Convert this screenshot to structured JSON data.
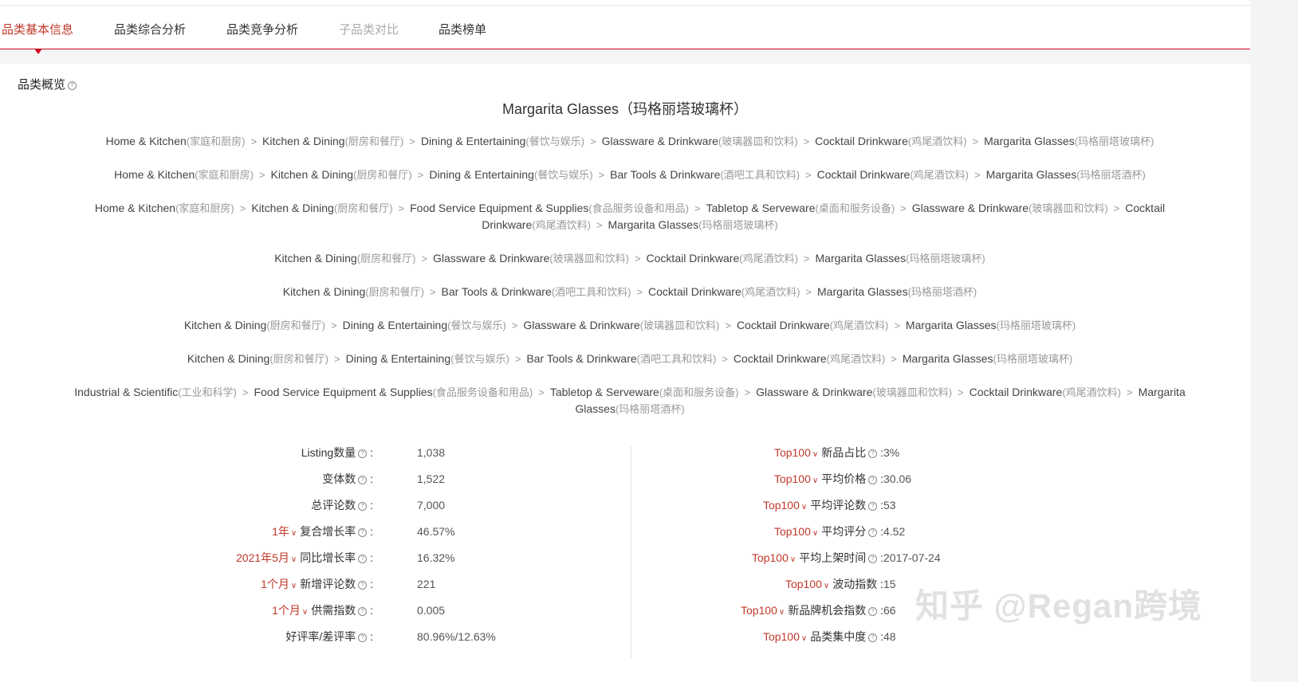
{
  "tabs": [
    {
      "label": "品类基本信息",
      "state": "active"
    },
    {
      "label": "品类综合分析",
      "state": "normal"
    },
    {
      "label": "品类竞争分析",
      "state": "normal"
    },
    {
      "label": "子品类对比",
      "state": "disabled"
    },
    {
      "label": "品类榜单",
      "state": "normal"
    }
  ],
  "section_title": "品类概览",
  "category_title": "Margarita Glasses（玛格丽塔玻璃杯）",
  "paths": [
    {
      "segments": [
        {
          "en": "Home & Kitchen",
          "cn": "(家庭和厨房)"
        },
        {
          "en": "Kitchen & Dining",
          "cn": "(厨房和餐厅)"
        },
        {
          "en": "Dining & Entertaining",
          "cn": "(餐饮与娱乐)"
        },
        {
          "en": "Glassware & Drinkware",
          "cn": "(玻璃器皿和饮料)"
        },
        {
          "en": "Cocktail Drinkware",
          "cn": "(鸡尾酒饮料)"
        },
        {
          "en": "Margarita Glasses",
          "cn": "(玛格丽塔玻璃杯)"
        }
      ]
    },
    {
      "segments": [
        {
          "en": "Home & Kitchen",
          "cn": "(家庭和厨房)"
        },
        {
          "en": "Kitchen & Dining",
          "cn": "(厨房和餐厅)"
        },
        {
          "en": "Dining & Entertaining",
          "cn": "(餐饮与娱乐)"
        },
        {
          "en": "Bar Tools & Drinkware",
          "cn": "(酒吧工具和饮料)"
        },
        {
          "en": "Cocktail Drinkware",
          "cn": "(鸡尾酒饮料)"
        },
        {
          "en": "Margarita Glasses",
          "cn": "(玛格丽塔酒杯)"
        }
      ]
    },
    {
      "segments": [
        {
          "en": "Home & Kitchen",
          "cn": "(家庭和厨房)"
        },
        {
          "en": "Kitchen & Dining",
          "cn": "(厨房和餐厅)"
        },
        {
          "en": "Food Service Equipment & Supplies",
          "cn": "(食品服务设备和用品)"
        },
        {
          "en": "Tabletop & Serveware",
          "cn": "(桌面和服务设备)"
        },
        {
          "en": "Glassware & Drinkware",
          "cn": "(玻璃器皿和饮料)"
        },
        {
          "en": "Cocktail Drinkware",
          "cn": "(鸡尾酒饮料)"
        },
        {
          "en": "Margarita Glasses",
          "cn": "(玛格丽塔玻璃杯)"
        }
      ]
    },
    {
      "segments": [
        {
          "en": "Kitchen & Dining",
          "cn": "(厨房和餐厅)"
        },
        {
          "en": "Glassware & Drinkware",
          "cn": "(玻璃器皿和饮料)"
        },
        {
          "en": "Cocktail Drinkware",
          "cn": "(鸡尾酒饮料)"
        },
        {
          "en": "Margarita Glasses",
          "cn": "(玛格丽塔玻璃杯)"
        }
      ]
    },
    {
      "segments": [
        {
          "en": "Kitchen & Dining",
          "cn": "(厨房和餐厅)"
        },
        {
          "en": "Bar Tools & Drinkware",
          "cn": "(酒吧工具和饮料)"
        },
        {
          "en": "Cocktail Drinkware",
          "cn": "(鸡尾酒饮料)"
        },
        {
          "en": "Margarita Glasses",
          "cn": "(玛格丽塔酒杯)"
        }
      ]
    },
    {
      "segments": [
        {
          "en": "Kitchen & Dining",
          "cn": "(厨房和餐厅)"
        },
        {
          "en": "Dining & Entertaining",
          "cn": "(餐饮与娱乐)"
        },
        {
          "en": "Glassware & Drinkware",
          "cn": "(玻璃器皿和饮料)"
        },
        {
          "en": "Cocktail Drinkware",
          "cn": "(鸡尾酒饮料)"
        },
        {
          "en": "Margarita Glasses",
          "cn": "(玛格丽塔玻璃杯)"
        }
      ]
    },
    {
      "segments": [
        {
          "en": "Kitchen & Dining",
          "cn": "(厨房和餐厅)"
        },
        {
          "en": "Dining & Entertaining",
          "cn": "(餐饮与娱乐)"
        },
        {
          "en": "Bar Tools & Drinkware",
          "cn": "(酒吧工具和饮料)"
        },
        {
          "en": "Cocktail Drinkware",
          "cn": "(鸡尾酒饮料)"
        },
        {
          "en": "Margarita Glasses",
          "cn": "(玛格丽塔玻璃杯)"
        }
      ]
    },
    {
      "segments": [
        {
          "en": "Industrial & Scientific",
          "cn": "(工业和科学)"
        },
        {
          "en": "Food Service Equipment & Supplies",
          "cn": "(食品服务设备和用品)"
        },
        {
          "en": "Tabletop & Serveware",
          "cn": "(桌面和服务设备)"
        },
        {
          "en": "Glassware & Drinkware",
          "cn": "(玻璃器皿和饮料)"
        },
        {
          "en": "Cocktail Drinkware",
          "cn": "(鸡尾酒饮料)"
        },
        {
          "en": "Margarita Glasses",
          "cn": "(玛格丽塔酒杯)"
        }
      ]
    }
  ],
  "metrics_left": [
    {
      "prefix": "",
      "label": "Listing数量",
      "help": true,
      "value": "1,038"
    },
    {
      "prefix": "",
      "label": "变体数",
      "help": true,
      "value": "1,522"
    },
    {
      "prefix": "",
      "label": "总评论数",
      "help": true,
      "value": "7,000"
    },
    {
      "prefix": "1年",
      "label": "复合增长率",
      "help": true,
      "value": "46.57%"
    },
    {
      "prefix": "2021年5月",
      "label": "同比增长率",
      "help": true,
      "value": "16.32%"
    },
    {
      "prefix": "1个月",
      "label": "新增评论数",
      "help": true,
      "value": "221"
    },
    {
      "prefix": "1个月",
      "label": "供需指数",
      "help": true,
      "value": "0.005"
    },
    {
      "prefix": "",
      "label": "好评率/差评率",
      "help": true,
      "value": "80.96%/12.63%"
    }
  ],
  "metrics_right": [
    {
      "prefix": "Top100",
      "label": "新品占比",
      "help": true,
      "value": "3%"
    },
    {
      "prefix": "Top100",
      "label": "平均价格",
      "help": true,
      "value": "30.06"
    },
    {
      "prefix": "Top100",
      "label": "平均评论数",
      "help": true,
      "value": "53"
    },
    {
      "prefix": "Top100",
      "label": "平均评分",
      "help": true,
      "value": "4.52"
    },
    {
      "prefix": "Top100",
      "label": "平均上架时间",
      "help": true,
      "value": "2017-07-24"
    },
    {
      "prefix": "Top100",
      "label": "波动指数",
      "help": false,
      "value": "15"
    },
    {
      "prefix": "Top100",
      "label": "新品牌机会指数",
      "help": true,
      "value": "66"
    },
    {
      "prefix": "Top100",
      "label": "品类集中度",
      "help": true,
      "value": "48"
    }
  ],
  "watermark": "知乎 @Regan跨境",
  "colors": {
    "accent": "#c0392b",
    "tab_border": "#d0021b"
  }
}
